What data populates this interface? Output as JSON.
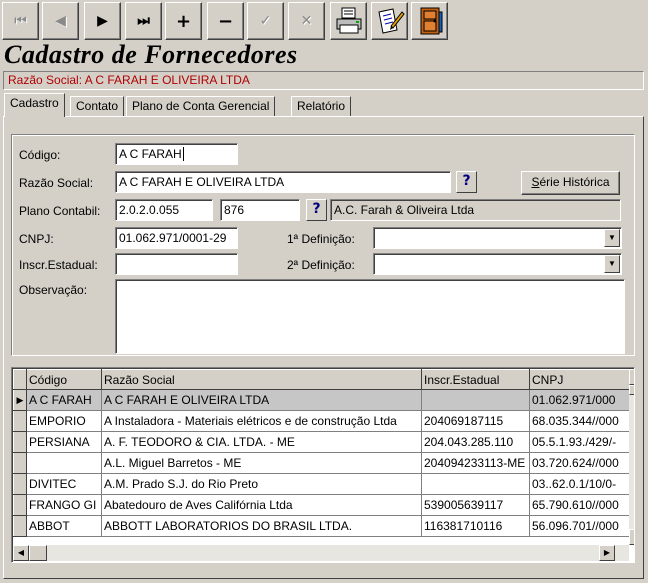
{
  "toolbar": {
    "first": "⏮",
    "prior": "◀",
    "next": "▶",
    "last": "⏭",
    "insert": "+",
    "delete": "−",
    "post": "✓",
    "cancel": "✕"
  },
  "page_title": "Cadastro de Fornecedores",
  "banner": "Razão Social: A C FARAH E OLIVEIRA LTDA",
  "tabs": [
    "Cadastro",
    "Contato",
    "Plano de Conta Gerencial",
    "Relatório"
  ],
  "form": {
    "codigo_label": "Código:",
    "codigo_value": "A C FARAH",
    "razao_label": "Razão Social:",
    "razao_value": "A C FARAH E OLIVEIRA LTDA",
    "plano_label": "Plano Contabil:",
    "plano_code": "2.0.2.0.055",
    "plano_num": "876",
    "plano_desc": "A.C. Farah & Oliveira Ltda",
    "cnpj_label": "CNPJ:",
    "cnpj_value": "01.062.971/0001-29",
    "inscr_label": "Inscr.Estadual:",
    "inscr_value": "",
    "def1_label": "1ª Definição:",
    "def1_value": "",
    "def2_label": "2ª Definição:",
    "def2_value": "",
    "obs_label": "Observação:",
    "obs_value": "",
    "q_label": "?",
    "serie_button": "Série Histórica"
  },
  "grid": {
    "columns": [
      "Código",
      "Razão Social",
      "Inscr.Estadual",
      "CNPJ"
    ],
    "rows": [
      [
        "A C FARAH",
        "A C FARAH E OLIVEIRA LTDA",
        "",
        "01.062.971/000"
      ],
      [
        "EMPORIO",
        "A Instaladora - Materiais elétricos e de construção Ltda",
        "204069187115",
        "68.035.344//000"
      ],
      [
        "PERSIANA",
        "A. F. TEODORO & CIA. LTDA. - ME",
        "204.043.285.110",
        "05.5.1.93./429/-"
      ],
      [
        "",
        "A.L. Miguel Barretos - ME",
        "204094233113-ME",
        "03.720.624//000"
      ],
      [
        "DIVITEC",
        "A.M. Prado S.J. do Rio Preto",
        "",
        "03..62.0.1/10/0-"
      ],
      [
        "FRANGO GI",
        "Abatedouro de Aves Califórnia Ltda",
        "539005639117",
        "65.790.610//000"
      ],
      [
        "ABBOT",
        "ABBOTT LABORATORIOS DO BRASIL LTDA.",
        "116381710116",
        "56.096.701//000"
      ]
    ]
  }
}
